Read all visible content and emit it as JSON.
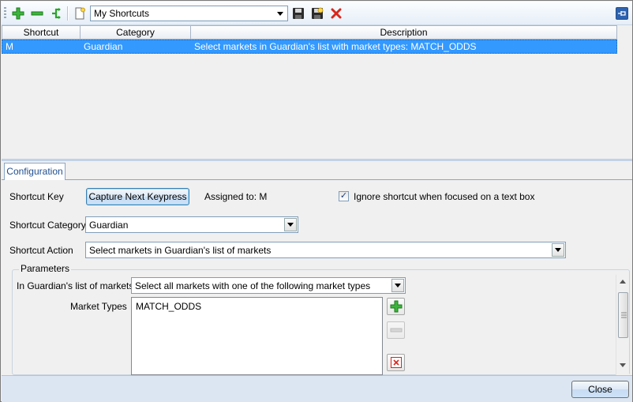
{
  "toolbar": {
    "shortcut_set": "My Shortcuts",
    "pin_icon": "pin-icon"
  },
  "grid": {
    "columns": [
      "Shortcut",
      "Category",
      "Description"
    ],
    "rows": [
      {
        "shortcut": "M",
        "category": "Guardian",
        "description": "Select markets in Guardian's list with market types: MATCH_ODDS"
      }
    ]
  },
  "tabs": [
    "Configuration"
  ],
  "config": {
    "shortcut_key_label": "Shortcut Key",
    "capture_button": "Capture Next Keypress",
    "assigned_to": "Assigned to: M",
    "ignore_checkbox_label": "Ignore shortcut when focused on a text box",
    "ignore_checked": "✓",
    "category_label": "Shortcut Category",
    "category_value": "Guardian",
    "action_label": "Shortcut Action",
    "action_value": "Select markets in Guardian's list of markets"
  },
  "parameters": {
    "legend": "Parameters",
    "list_label": "In Guardian's list of markets:",
    "list_value": "Select all markets with one of the following market types",
    "market_types_label": "Market Types",
    "market_types": [
      "MATCH_ODDS"
    ]
  },
  "footer": {
    "close_button": "Close"
  },
  "colors": {
    "selection": "#3399ff",
    "add_green": "#2aa52a",
    "delete_red": "#d9261c"
  }
}
